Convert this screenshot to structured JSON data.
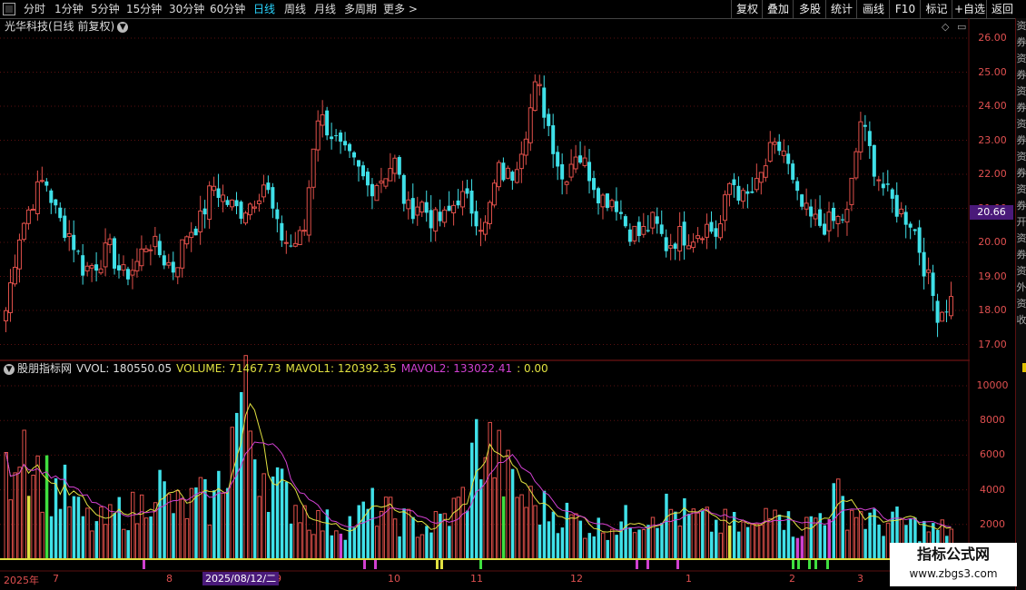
{
  "toolbar": {
    "periods": [
      "分时",
      "1分钟",
      "5分钟",
      "15分钟",
      "30分钟",
      "60分钟",
      "日线",
      "周线",
      "月线",
      "多周期",
      "更多 >"
    ],
    "active_period": "日线",
    "right_buttons": [
      "复权",
      "叠加",
      "多股",
      "统计",
      "画线",
      "F10",
      "标记",
      "+自选",
      "返回"
    ]
  },
  "chart_title": "光华科技(日线 前复权)",
  "indicator": {
    "name": "股朋指标网",
    "vvol": "VVOL: 180550.05",
    "volume": "VOLUME: 71467.73",
    "mavol1": "MAVOL1: 120392.35",
    "mavol2": "MAVOL2: 133022.41",
    "extra": ": 0.00"
  },
  "price_axis": [
    "26.00",
    "25.00",
    "24.00",
    "23.00",
    "22.00",
    "21.00",
    "20.00",
    "19.00",
    "18.00",
    "17.00"
  ],
  "current_price": "20.66",
  "volume_axis": [
    "10000",
    "8000",
    "6000",
    "4000",
    "2000"
  ],
  "date_axis": [
    "2025年",
    "7",
    "8",
    "9",
    "10",
    "11",
    "12",
    "1",
    "2",
    "3"
  ],
  "cursor_date": "2025/08/12/二",
  "sidebar_chars": "资券资券资券资券资券资券开资券资外资收",
  "watermark": {
    "line1": "指标公式网",
    "line2": "www.zbgs3.com"
  },
  "colors": {
    "up": "#e0504a",
    "down": "#3fe0e8",
    "ma1": "#e0e040",
    "ma2": "#d040d0",
    "grid": "#5a1010"
  },
  "chart_data": [
    {
      "type": "candlestick",
      "title": "光华科技(日线 前复权)",
      "x_range": [
        "2025-06-27",
        "2026-03-12"
      ],
      "ylim": [
        17.0,
        26.0
      ],
      "y_ticks": [
        17,
        18,
        19,
        20,
        21,
        22,
        23,
        24,
        25,
        26
      ],
      "last_close": 20.66,
      "close_trend": [
        18.0,
        20.2,
        21.2,
        21.9,
        20.7,
        20.2,
        19.2,
        19.4,
        19.8,
        19.0,
        19.3,
        20.1,
        19.6,
        19.2,
        20.3,
        20.6,
        21.7,
        21.2,
        20.9,
        21.2,
        21.8,
        20.3,
        19.9,
        20.2,
        23.8,
        23.3,
        22.6,
        22.2,
        21.6,
        21.9,
        22.4,
        20.9,
        21.2,
        20.6,
        20.7,
        21.4,
        21.0,
        20.4,
        22.1,
        21.9,
        23.1,
        24.7,
        23.3,
        21.8,
        22.7,
        22.1,
        21.3,
        21.3,
        20.4,
        20.2,
        20.6,
        19.9,
        20.2,
        20.2,
        20.5,
        20.2,
        21.9,
        21.2,
        21.6,
        22.6,
        22.8,
        21.3,
        20.7,
        20.5,
        20.6,
        20.8,
        23.6,
        22.3,
        21.4,
        20.9,
        20.6,
        19.2,
        17.9,
        18.3
      ]
    },
    {
      "type": "bar",
      "title": "股朋指标网",
      "ylim": [
        0,
        11000
      ],
      "y_ticks": [
        2000,
        4000,
        6000,
        8000,
        10000
      ],
      "series": [
        {
          "name": "VOLUME",
          "last_value": 71467.73
        },
        {
          "name": "MAVOL1",
          "last_value": 120392.35
        },
        {
          "name": "MAVOL2",
          "last_value": 133022.41
        },
        {
          "name": "VVOL",
          "last_value": 180550.05
        }
      ],
      "volume_trend": [
        4500,
        8000,
        5200,
        4200,
        3800,
        2500,
        2000,
        2200,
        3000,
        2600,
        4800,
        3200,
        2800,
        3500,
        3000,
        6000,
        9500,
        6000,
        4500,
        3500,
        3000,
        2200,
        2000,
        2000,
        2500,
        3000,
        2500,
        2200,
        1800,
        2000,
        2500,
        3500,
        7000,
        6000,
        4500,
        3500,
        3000,
        2800,
        2500,
        2000,
        1800,
        2000,
        2200,
        2500,
        3000,
        2800,
        2500,
        2200,
        2000,
        2000,
        1800,
        1600,
        4500,
        2000,
        1800,
        2500,
        3500,
        3000,
        2500,
        2000,
        2200,
        2000,
        1800,
        1600,
        1800
      ]
    }
  ]
}
